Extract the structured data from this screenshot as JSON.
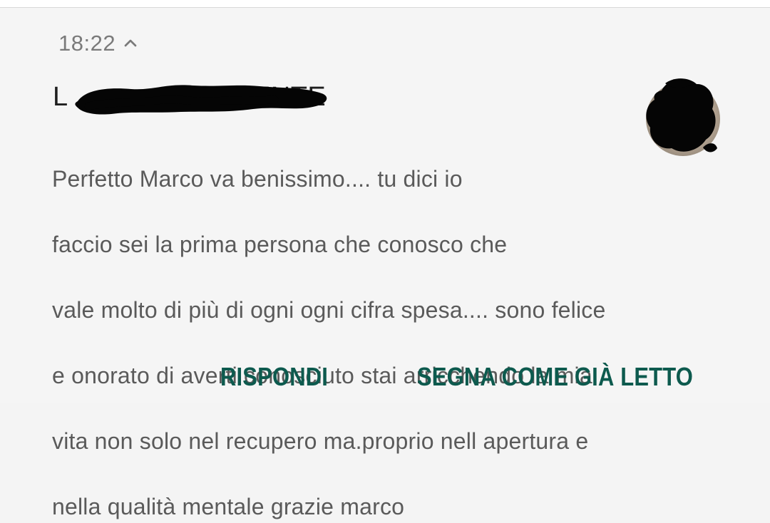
{
  "notification": {
    "time": "18:22",
    "title_visible_prefix": "L",
    "title_visible_suffix": "CLIENTE",
    "message_lines": [
      "Perfetto Marco va benissimo.... tu dici io",
      "faccio sei la prima persona che conosco che",
      "vale molto di più di ogni ogni cifra spesa.... sono felice",
      "e onorato di averti conosciuto stai arricchendo la mia",
      "vita non solo nel recupero ma.proprio nell apertura e",
      "nella qualità mentale grazie marco"
    ],
    "actions": {
      "reply_label": "RISPONDI",
      "mark_read_label": "SEGNA COME GIÀ LETTO"
    }
  },
  "colors": {
    "background": "#f5f5f5",
    "time_text": "#7a7a7a",
    "title_text": "#1e1e1e",
    "message_text": "#5a5a5a",
    "action_text": "#0d5a4e",
    "redaction": "#050505"
  },
  "icons": {
    "expand": "chevron-up-icon",
    "avatar": "contact-avatar"
  }
}
